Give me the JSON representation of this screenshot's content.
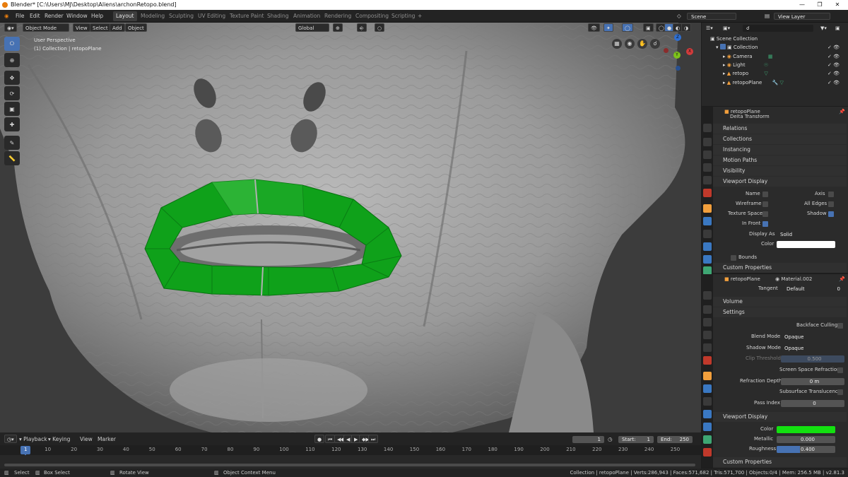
{
  "titlebar": {
    "title": "Blender* [C:\\Users\\MJ\\Desktop\\Aliens\\archonRetopo.blend]"
  },
  "menus": [
    "File",
    "Edit",
    "Render",
    "Window",
    "Help"
  ],
  "workspaces": [
    "Layout",
    "Modeling",
    "Sculpting",
    "UV Editing",
    "Texture Paint",
    "Shading",
    "Animation",
    "Rendering",
    "Compositing",
    "Scripting"
  ],
  "scene": "Scene",
  "view_layer": "View Layer",
  "viewport": {
    "mode": "Object Mode",
    "menus": [
      "View",
      "Select",
      "Add",
      "Object"
    ],
    "orientation": "Global",
    "overlay_title": "User Perspective",
    "overlay_sub": "(1) Collection | retopoPlane"
  },
  "gizmo": {
    "x": "X",
    "y": "Y",
    "z": "Z"
  },
  "outliner": {
    "scene_collection": "Scene Collection",
    "collection": "Collection",
    "items": [
      "Camera",
      "Light",
      "retopo",
      "retopoPlane"
    ]
  },
  "object_props": {
    "object": "retopoPlane",
    "cut_label": "Delta Transform",
    "sections": [
      "Relations",
      "Collections",
      "Instancing",
      "Motion Paths",
      "Visibility"
    ],
    "viewport_display": "Viewport Display",
    "checks": {
      "name": "Name",
      "axis": "Axis",
      "wireframe": "Wireframe",
      "all_edges": "All Edges",
      "texture_space": "Texture Space",
      "shadow": "Shadow",
      "in_front": "In Front"
    },
    "display_as_label": "Display As",
    "display_as": "Solid",
    "color_label": "Color",
    "bounds": "Bounds",
    "custom": "Custom Properties"
  },
  "material_props": {
    "object": "retopoPlane",
    "material": "Material.002",
    "tangent_label": "Tangent",
    "tangent": "Default",
    "tangent_val": "0",
    "volume": "Volume",
    "settings": "Settings",
    "backface": "Backface Culling",
    "blend_label": "Blend Mode",
    "blend": "Opaque",
    "shadow_label": "Shadow Mode",
    "shadow": "Opaque",
    "clip_label": "Clip Threshold",
    "clip": "0.500",
    "ssr": "Screen Space Refraction",
    "refr_label": "Refraction Depth",
    "refr": "0 m",
    "sst": "Subsurface Translucency",
    "pass_label": "Pass Index",
    "pass": "0",
    "vd": "Viewport Display",
    "color_label": "Color",
    "metallic_label": "Metallic",
    "metallic": "0.000",
    "metallic_fill": 0,
    "roughness_label": "Roughness",
    "roughness": "0.400",
    "roughness_fill": 0.4,
    "custom": "Custom Properties"
  },
  "timeline": {
    "menus": [
      "Playback",
      "Keying",
      "View",
      "Marker"
    ],
    "current": "1",
    "start_label": "Start:",
    "start": "1",
    "end_label": "End:",
    "end": "250",
    "ticks": [
      "1",
      "10",
      "20",
      "30",
      "40",
      "50",
      "60",
      "70",
      "80",
      "90",
      "100",
      "110",
      "120",
      "130",
      "140",
      "150",
      "160",
      "170",
      "180",
      "190",
      "200",
      "210",
      "220",
      "230",
      "240",
      "250"
    ]
  },
  "status": {
    "select": "Select",
    "box_select": "Box Select",
    "rotate": "Rotate View",
    "context": "Object Context Menu",
    "info": "Collection | retopoPlane | Verts:286,943 | Faces:571,682 | Tris:571,700 | Objects:0/4 | Mem: 256.5 MB | v2.81.3"
  },
  "colors": {
    "accent": "#4772b3",
    "mesh_green": "#0fa11a",
    "viewport_color": "#ffffff",
    "material_color": "#13e010"
  }
}
